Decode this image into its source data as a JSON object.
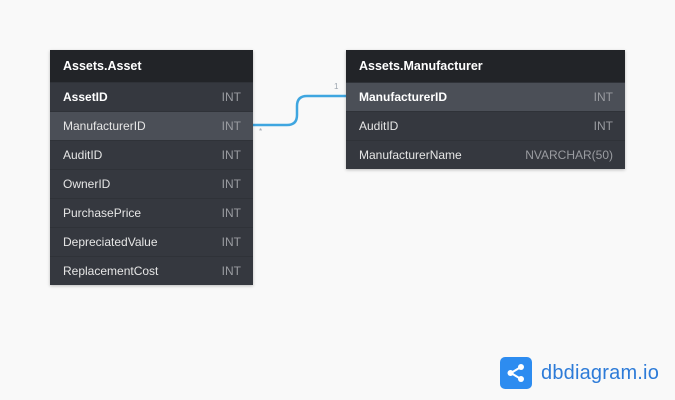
{
  "tables": [
    {
      "name": "Assets.Asset",
      "columns": [
        {
          "name": "AssetID",
          "type": "INT"
        },
        {
          "name": "ManufacturerID",
          "type": "INT"
        },
        {
          "name": "AuditID",
          "type": "INT"
        },
        {
          "name": "OwnerID",
          "type": "INT"
        },
        {
          "name": "PurchasePrice",
          "type": "INT"
        },
        {
          "name": "DepreciatedValue",
          "type": "INT"
        },
        {
          "name": "ReplacementCost",
          "type": "INT"
        }
      ]
    },
    {
      "name": "Assets.Manufacturer",
      "columns": [
        {
          "name": "ManufacturerID",
          "type": "INT"
        },
        {
          "name": "AuditID",
          "type": "INT"
        },
        {
          "name": "ManufacturerName",
          "type": "NVARCHAR(50)"
        }
      ]
    }
  ],
  "relationship": {
    "from": "Assets.Asset.ManufacturerID",
    "to": "Assets.Manufacturer.ManufacturerID",
    "from_cardinality": "*",
    "to_cardinality": "1",
    "color": "#3fa6e0"
  },
  "brand": {
    "text": "dbdiagram.io",
    "logo_icon": "share-nodes-icon",
    "color": "#2d8cf0"
  }
}
